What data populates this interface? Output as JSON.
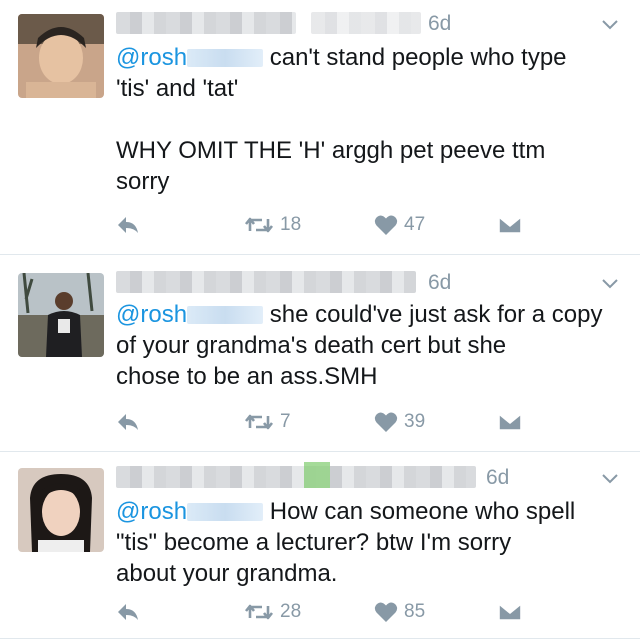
{
  "tweets": [
    {
      "time": "6d",
      "mention": "@rosh",
      "body_lines": [
        "can't stand people who type",
        "'tis' and 'tat'",
        "",
        "WHY OMIT THE 'H' arggh pet peeve ttm",
        "sorry"
      ],
      "retweets": "18",
      "likes": "47"
    },
    {
      "time": "6d",
      "mention": "@rosh",
      "body_lines": [
        "she could've just ask for a copy",
        "of your grandma's death cert but she",
        "chose to be an ass.SMH"
      ],
      "retweets": "7",
      "likes": "39"
    },
    {
      "time": "6d",
      "mention": "@rosh",
      "body_lines": [
        "How can someone who spell",
        "\"tis\" become a lecturer? btw I'm sorry",
        "about your grandma."
      ],
      "retweets": "28",
      "likes": "85"
    }
  ],
  "icons": {
    "reply": "reply-icon",
    "retweet": "retweet-icon",
    "like": "heart-icon",
    "dm": "direct-message-icon",
    "more": "chevron-down-icon"
  },
  "colors": {
    "meta": "#8899a6",
    "mention": "#1b95e0",
    "text": "#14171a"
  }
}
